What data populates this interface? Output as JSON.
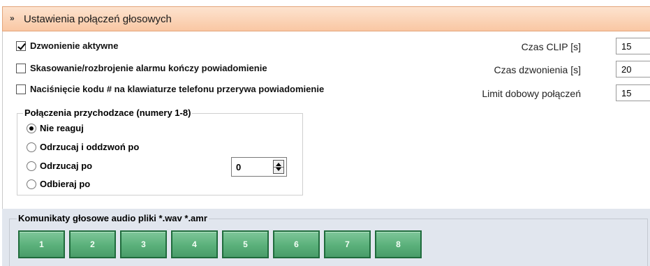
{
  "header": {
    "title": "Ustawienia połączeń głosowych",
    "chevron": "»"
  },
  "checkboxes": [
    {
      "label": "Dzwonienie aktywne",
      "checked": true
    },
    {
      "label": "Skasowanie/rozbrojenie  alarmu  kończy powiadomienie",
      "checked": false
    },
    {
      "label": "Naciśnięcie kodu # na klawiaturze telefonu przerywa powiadomienie",
      "checked": false
    }
  ],
  "incoming": {
    "title": "Połączenia przychodzace (numery 1-8)",
    "options": [
      "Nie reaguj",
      "Odrzucaj i oddzwoń po",
      "Odrzucaj po",
      "Odbieraj po"
    ],
    "selected": "Nie reaguj",
    "spinner_value": "0"
  },
  "params": [
    {
      "label": "Czas CLIP [s]",
      "value": "15"
    },
    {
      "label": "Czas dzwonienia [s]",
      "value": "20"
    },
    {
      "label": "Limit dobowy połączeń",
      "value": "15"
    }
  ],
  "audio": {
    "title": "Komunikaty głosowe audio pliki *.wav *.amr",
    "buttons": [
      "1",
      "2",
      "3",
      "4",
      "5",
      "6",
      "7",
      "8"
    ]
  }
}
